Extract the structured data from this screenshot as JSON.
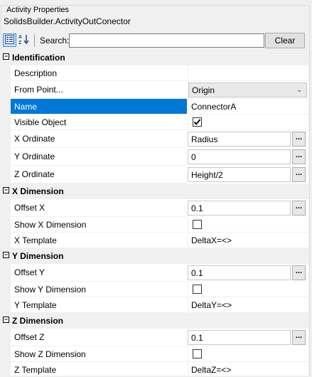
{
  "group_title": "Activity Properties",
  "object_name": "SolidsBuilder.ActivityOutConector",
  "toolbar": {
    "categorized_icon": "categorized-view-icon",
    "alphabetical_icon": "alphabetical-sort-icon",
    "search_label": "Search:",
    "search_value": "",
    "clear_label": "Clear"
  },
  "colors": {
    "selected": "#0078d7",
    "category_bg": "#f0f0f0"
  },
  "categories": [
    {
      "label": "Identification",
      "expand_symbol": "−",
      "properties": [
        {
          "name": "Description",
          "value": ""
        },
        {
          "name": "From Point...",
          "value": "Origin",
          "editor": "dropdown"
        },
        {
          "name": "Name",
          "value": "ConnectorA",
          "selected": true
        },
        {
          "name": "Visible Object",
          "checked": true,
          "editor": "checkbox"
        },
        {
          "name": "X Ordinate",
          "value": "Radius",
          "editor": "text-ellipsis"
        },
        {
          "name": "Y Ordinate",
          "value": "0",
          "editor": "text-ellipsis"
        },
        {
          "name": "Z Ordinate",
          "value": "Height/2",
          "editor": "text-ellipsis"
        }
      ]
    },
    {
      "label": "X Dimension",
      "expand_symbol": "−",
      "properties": [
        {
          "name": "Offset X",
          "value": "0.1",
          "editor": "text-ellipsis"
        },
        {
          "name": "Show X Dimension",
          "checked": false,
          "editor": "checkbox"
        },
        {
          "name": "X Template",
          "value": "DeltaX=<>"
        }
      ]
    },
    {
      "label": "Y Dimension",
      "expand_symbol": "−",
      "properties": [
        {
          "name": "Offset Y",
          "value": "0.1",
          "editor": "text-ellipsis"
        },
        {
          "name": "Show Y Dimension",
          "checked": false,
          "editor": "checkbox"
        },
        {
          "name": "Y Template",
          "value": "DeltaY=<>"
        }
      ]
    },
    {
      "label": "Z Dimension",
      "expand_symbol": "−",
      "properties": [
        {
          "name": "Offset Z",
          "value": "0.1",
          "editor": "text-ellipsis"
        },
        {
          "name": "Show Z Dimension",
          "checked": false,
          "editor": "checkbox"
        },
        {
          "name": "Z Template",
          "value": "DeltaZ=<>"
        }
      ]
    }
  ],
  "ellipsis_label": "..."
}
